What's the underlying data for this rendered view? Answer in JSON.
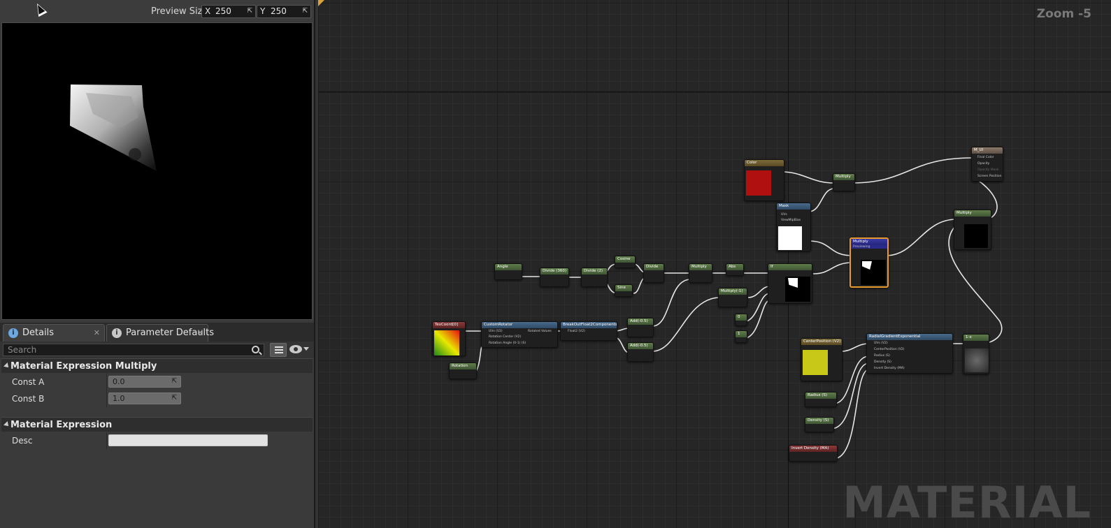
{
  "preview": {
    "size_label": "Preview Size",
    "x_axis": "X",
    "x_value": "250",
    "y_axis": "Y",
    "y_value": "250"
  },
  "tabs": [
    {
      "label": "Details"
    },
    {
      "label": "Parameter Defaults"
    }
  ],
  "search": {
    "placeholder": "Search"
  },
  "details": {
    "category1": "Material Expression Multiply",
    "const_a_label": "Const A",
    "const_a_value": "0.0",
    "const_b_label": "Const B",
    "const_b_value": "1.0",
    "category2": "Material Expression",
    "desc_label": "Desc",
    "desc_value": ""
  },
  "graph": {
    "zoom": "Zoom -5",
    "watermark": "MATERIAL",
    "nodes": {
      "color": "Color",
      "mask": "Mask",
      "multiply_top": "Multiply",
      "multiply_sel": "Multiply",
      "previewing": "Previewing",
      "multiply_right": "Multiply",
      "result": "M_UI",
      "result_pins": [
        "Final Color",
        "Opacity",
        "Opacity Mask",
        "Screen Position"
      ],
      "angle": "Angle",
      "divide_360": "Divide (360)",
      "divide_2": "Divide (2)",
      "cosine": "Cosine",
      "sine": "Sine",
      "divide": "Divide",
      "multiply_mid": "Multiply",
      "abs": "Abs",
      "if": "If",
      "multiply_neg1": "Multiply(-1)",
      "const_0": "0",
      "const_1": "1",
      "texcoord": "TexCoord[0]",
      "custom_rotator": "CustomRotator",
      "rotator_pins": [
        "UVs (V2)",
        "Rotation Center (V2)",
        "Rotation Angle (0-1) (S)"
      ],
      "rotated_values": "Rotated Values",
      "rotation": "Rotation",
      "breakout": "BreakOutFloat2Components",
      "breakout_pin": "Float2 (V2)",
      "add_a": "Add(-0.5)",
      "add_b": "Add(-0.5)",
      "center_position": "CenterPosition (V2)",
      "radial": "RadialGradientExponential",
      "radial_pins": [
        "UVs (V2)",
        "CenterPosition (V2)",
        "Radius (S)",
        "Density (S)",
        "Invert Density (MA)"
      ],
      "radius": "Radius (S)",
      "density": "Density (S)",
      "invert_density": "Invert Density (MA)",
      "one_minus": "1-x",
      "mask_pins": [
        "UVs",
        "ViewMipBias"
      ]
    }
  },
  "colors": {
    "accent_selected": "#e89a2c",
    "color_swatch": "#b01010",
    "center_swatch": "#c8c818"
  }
}
